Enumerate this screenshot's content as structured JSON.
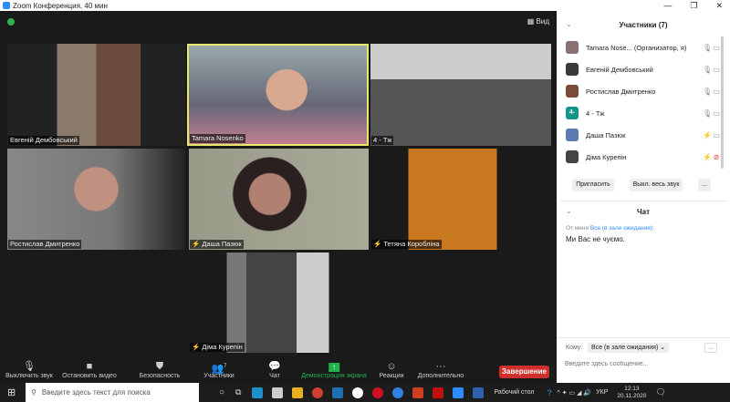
{
  "window": {
    "title": "Zoom Конференция, 40 мин",
    "view_label": "Вид"
  },
  "tiles": [
    {
      "name": "Евгеній Дембовський",
      "muted": false
    },
    {
      "name": "Tamara Nosenko",
      "muted": false,
      "active": true
    },
    {
      "name": "4 - Тж",
      "muted": false
    },
    {
      "name": "Ростислав Дмитренко",
      "muted": false
    },
    {
      "name": "Даша Пазюк",
      "muted": true
    },
    {
      "name": "Тетяна Коробліна",
      "muted": true
    },
    {
      "name": "Діма Курепін",
      "muted": true
    }
  ],
  "toolbar": {
    "mute": "Выключить звук",
    "video": "Остановить видео",
    "security": "Безопасность",
    "participants": "Участники",
    "participants_count": "7",
    "chat": "Чат",
    "share": "Демонстрация экрана",
    "reactions": "Реакции",
    "more": "Дополнительно",
    "end": "Завершение"
  },
  "participants": {
    "title": "Участники (7)",
    "items": [
      {
        "name": "Tamara Nose...  (Организатор, я)",
        "avatar": "",
        "mic": "on",
        "cam": "on"
      },
      {
        "name": "Евгеній Дембовський",
        "mic": "on",
        "cam": "on"
      },
      {
        "name": "Ростислав Дмитренко",
        "mic": "on",
        "cam": "on"
      },
      {
        "name": "4 - Тж",
        "avatar": "4-",
        "mic": "on",
        "cam": "on"
      },
      {
        "name": "Даша Пазюк",
        "mic": "off",
        "cam": "on"
      },
      {
        "name": "Діма Курепін",
        "mic": "off",
        "cam": "off"
      }
    ],
    "invite": "Пригласить",
    "mute_all": "Выкл. весь звук",
    "more": "..."
  },
  "chat": {
    "title": "Чат",
    "from": "От меня",
    "to": "Все (в зале ожидания):",
    "message": "Ми Вас не чуємо.",
    "to_label": "Кому:",
    "to_value": "Все (в зале ожидания)",
    "placeholder": "Введите здесь сообщение...",
    "more": "..."
  },
  "taskbar": {
    "search": "Введите здесь текст для поиска",
    "desktop": "Рабочий стол",
    "lang": "УКР",
    "time": "12:13",
    "date": "20.11.2020"
  },
  "colors": {
    "accent": "#2d8cff",
    "end": "#d0302b",
    "share": "#23b14d",
    "active_border": "#e8e86a"
  }
}
